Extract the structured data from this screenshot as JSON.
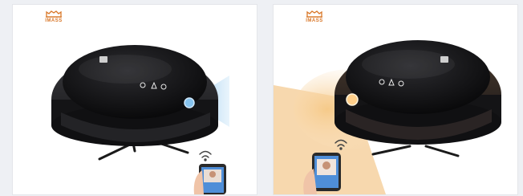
{
  "brand": {
    "name": "IMASS",
    "color": "#d9782a"
  },
  "panels": [
    {
      "id": "left",
      "light": "blue",
      "icons": [
        "wifi-icon",
        "phone-icon",
        "robot-vacuum-icon"
      ]
    },
    {
      "id": "right",
      "light": "warm",
      "icons": [
        "wifi-icon",
        "phone-icon",
        "robot-vacuum-icon"
      ]
    }
  ],
  "colors": {
    "blue_light": "#6fb4e6",
    "warm_light": "#f0b870",
    "body": "#1b1b1e"
  }
}
